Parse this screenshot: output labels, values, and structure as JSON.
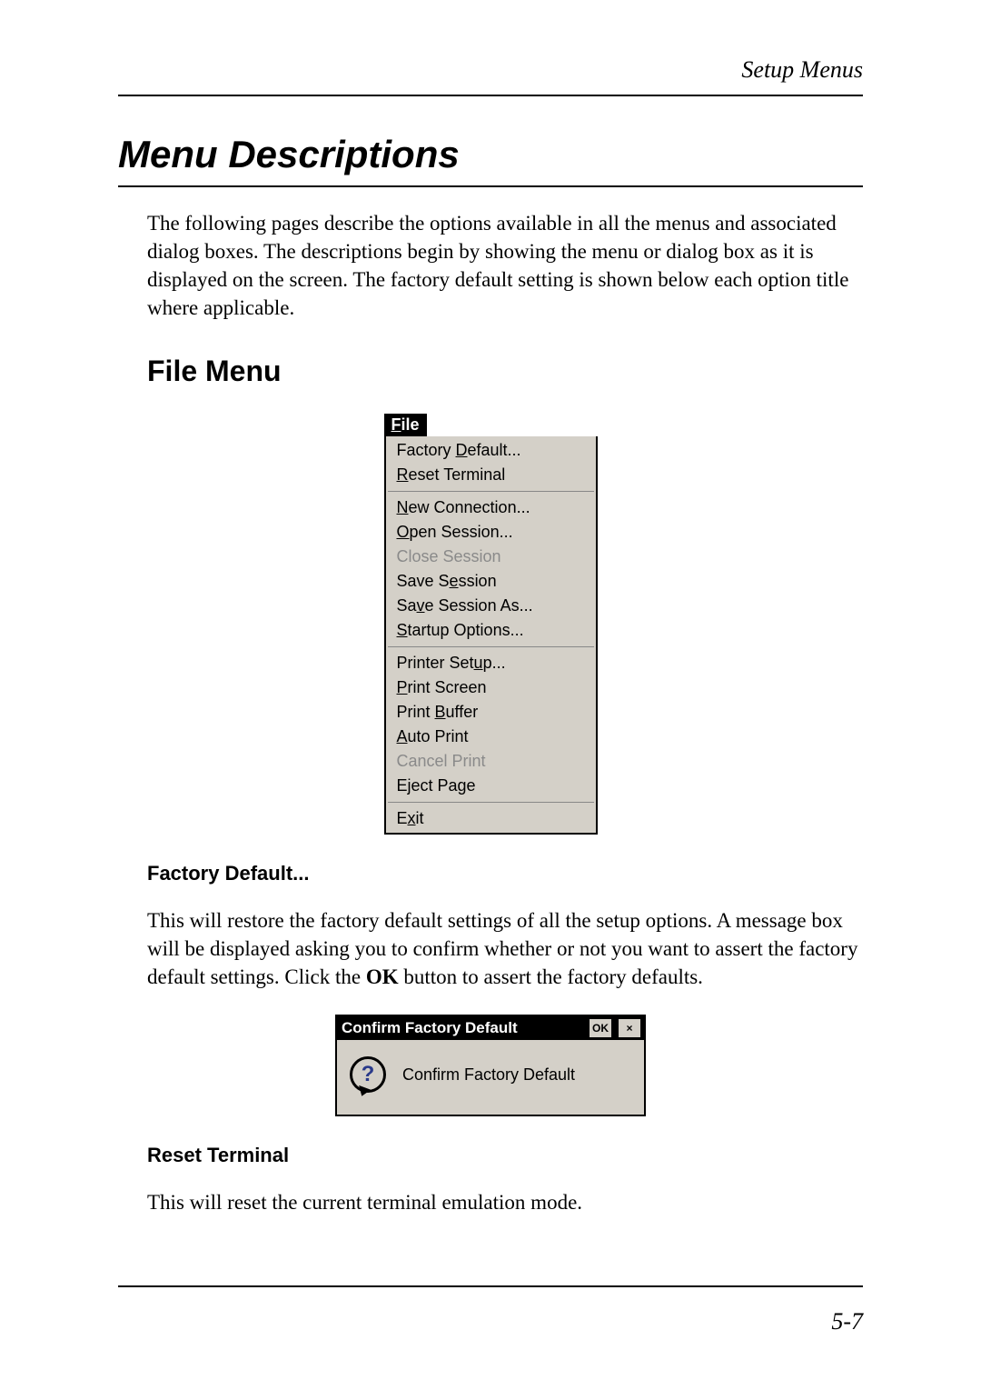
{
  "header": {
    "running_title": "Setup Menus"
  },
  "main_title": "Menu Descriptions",
  "intro_text": "The following pages describe the options available in all the menus and associated dialog boxes. The descriptions begin by showing the menu or dialog box as it is displayed on the screen. The factory default setting is shown below each option title where applicable.",
  "section_heading": "File Menu",
  "file_menu": {
    "tab_before": "F",
    "tab_accel": "",
    "tab_after": "ile",
    "groups": [
      [
        {
          "pre": "Factory ",
          "accel": "D",
          "post": "efault...",
          "disabled": false
        },
        {
          "pre": "",
          "accel": "R",
          "post": "eset Terminal",
          "disabled": false
        }
      ],
      [
        {
          "pre": "",
          "accel": "N",
          "post": "ew Connection...",
          "disabled": false
        },
        {
          "pre": "",
          "accel": "O",
          "post": "pen Session...",
          "disabled": false
        },
        {
          "pre": "Close Session",
          "accel": "",
          "post": "",
          "disabled": true
        },
        {
          "pre": "Save S",
          "accel": "e",
          "post": "ssion",
          "disabled": false
        },
        {
          "pre": "Sa",
          "accel": "v",
          "post": "e Session As...",
          "disabled": false
        },
        {
          "pre": "",
          "accel": "S",
          "post": "tartup Options...",
          "disabled": false
        }
      ],
      [
        {
          "pre": "Printer Set",
          "accel": "u",
          "post": "p...",
          "disabled": false
        },
        {
          "pre": "",
          "accel": "P",
          "post": "rint Screen",
          "disabled": false
        },
        {
          "pre": "Print ",
          "accel": "B",
          "post": "uffer",
          "disabled": false
        },
        {
          "pre": "",
          "accel": "A",
          "post": "uto Print",
          "disabled": false
        },
        {
          "pre": "Cancel Print",
          "accel": "",
          "post": "",
          "disabled": true
        },
        {
          "pre": "E",
          "accel": "j",
          "post": "ect Page",
          "disabled": false
        }
      ],
      [
        {
          "pre": "E",
          "accel": "x",
          "post": "it",
          "disabled": false
        }
      ]
    ]
  },
  "opt1": {
    "title": "Factory Default...",
    "body_before": "This will restore the factory default settings of all the setup options. A message box will be displayed asking you to confirm whether or not you want to assert the factory default settings. Click the ",
    "body_bold": "OK",
    "body_after": " button to assert the factory defaults."
  },
  "dialog": {
    "title": "Confirm Factory Default",
    "ok_label": "OK",
    "close_label": "×",
    "question_glyph": "?",
    "message": "Confirm Factory Default"
  },
  "opt2": {
    "title": "Reset Terminal",
    "body": "This will reset the current terminal emulation mode."
  },
  "footer": {
    "page_number": "5-7"
  }
}
